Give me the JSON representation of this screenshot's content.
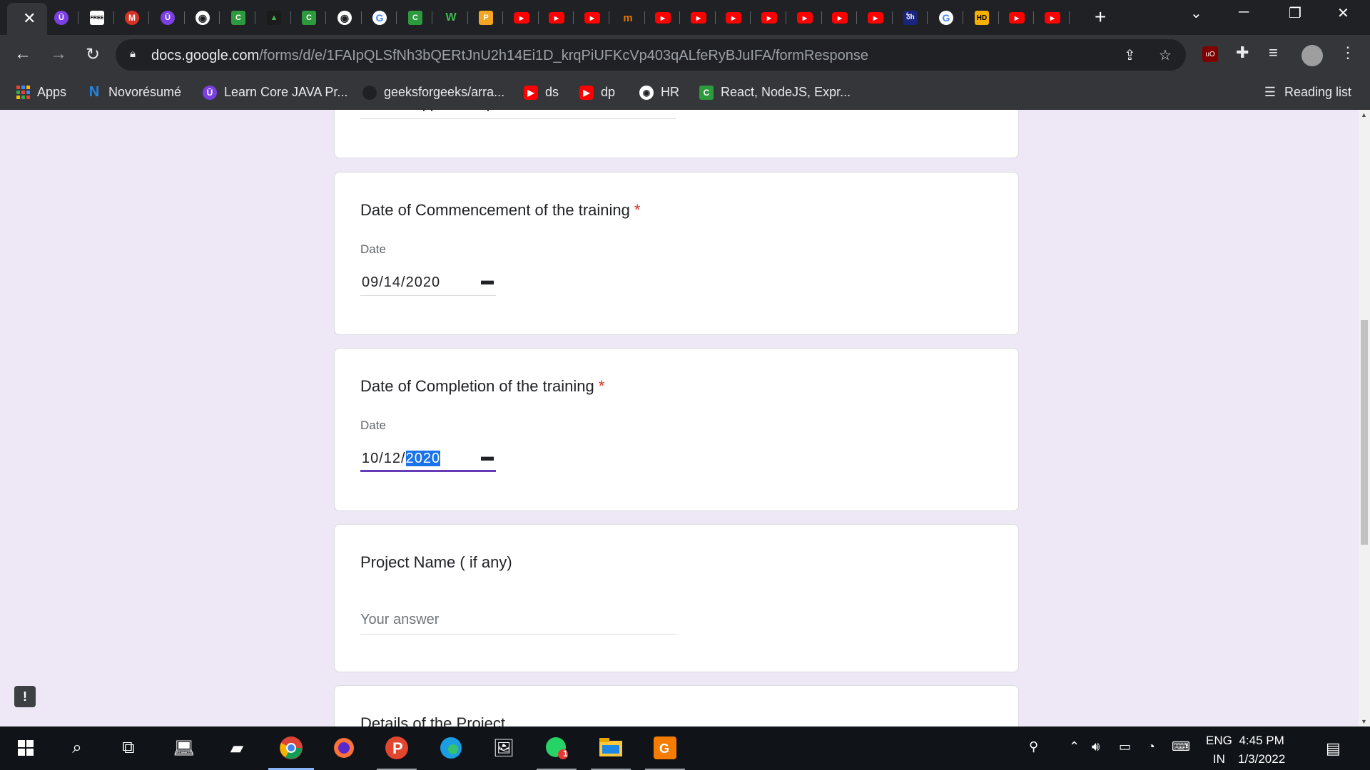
{
  "browser": {
    "url_host": "docs.google.com",
    "url_path": "/forms/d/e/1FAIpQLSfNh3bQERtJnU2h14Ei1D_krqPiUFKcVp403qALfeRyBJuIFA/formResponse",
    "tab_close_glyph": "✕",
    "new_tab_glyph": "+"
  },
  "tabs": [
    {
      "icon": "purple-u-icon",
      "text": "Ū"
    },
    {
      "icon": "free-icon",
      "text": "FREE"
    },
    {
      "icon": "gmail-icon",
      "text": "M"
    },
    {
      "icon": "purple-u-icon",
      "text": "Ū"
    },
    {
      "icon": "globe-icon",
      "text": "◉"
    },
    {
      "icon": "green-c-icon",
      "text": "C"
    },
    {
      "icon": "dark-site-icon",
      "text": "▲"
    },
    {
      "icon": "green-c-icon",
      "text": "C"
    },
    {
      "icon": "globe-icon",
      "text": "◉"
    },
    {
      "icon": "google-icon",
      "text": "G"
    },
    {
      "icon": "green-c-icon",
      "text": "C"
    },
    {
      "icon": "w-icon",
      "text": "W"
    },
    {
      "icon": "orange-p-icon",
      "text": "P"
    },
    {
      "icon": "youtube-icon",
      "text": "▶"
    },
    {
      "icon": "youtube-icon",
      "text": "▶"
    },
    {
      "icon": "youtube-icon",
      "text": "▶"
    },
    {
      "icon": "mm-icon",
      "text": "m"
    },
    {
      "icon": "youtube-icon",
      "text": "▶"
    },
    {
      "icon": "youtube-icon",
      "text": "▶"
    },
    {
      "icon": "youtube-icon",
      "text": "▶"
    },
    {
      "icon": "youtube-icon",
      "text": "▶"
    },
    {
      "icon": "youtube-icon",
      "text": "▶"
    },
    {
      "icon": "youtube-icon",
      "text": "▶"
    },
    {
      "icon": "youtube-icon",
      "text": "▶"
    },
    {
      "icon": "navy-site-icon",
      "text": "ঠh"
    },
    {
      "icon": "google-icon",
      "text": "G"
    },
    {
      "icon": "hd-icon",
      "text": "HD"
    },
    {
      "icon": "youtube-icon",
      "text": "▶"
    },
    {
      "icon": "youtube-icon",
      "text": "▶"
    }
  ],
  "bookmarks": [
    {
      "label": "Apps",
      "icon": "apps-grid-icon"
    },
    {
      "label": "Novorésumé",
      "icon": "novoresume-icon"
    },
    {
      "label": "Learn Core JAVA Pr...",
      "icon": "purple-u-icon"
    },
    {
      "label": "geeksforgeeks/arra...",
      "icon": "github-icon"
    },
    {
      "label": "ds",
      "icon": "youtube-icon"
    },
    {
      "label": "dp",
      "icon": "youtube-icon"
    },
    {
      "label": "HR",
      "icon": "globe-icon"
    },
    {
      "label": "React, NodeJS, Expr...",
      "icon": "green-c-icon"
    }
  ],
  "reading_list": "Reading list",
  "form": {
    "prev_card_answer": "Android App Development",
    "commencement": {
      "title": "Date of Commencement of the training",
      "required": "*",
      "label": "Date",
      "value": "09/14/2020"
    },
    "completion": {
      "title": "Date of Completion of the training",
      "required": "*",
      "label": "Date",
      "value_prefix": "10/12/",
      "value_selected": "2020"
    },
    "project_name": {
      "title": "Project Name ( if any)",
      "placeholder": "Your answer"
    },
    "next_card_title": "Details of the Project"
  },
  "feedback_glyph": "!",
  "taskbar": {
    "lang_line1": "ENG",
    "lang_line2": "IN",
    "time": "4:45 PM",
    "date": "1/3/2022",
    "whatsapp_badge": "1"
  }
}
